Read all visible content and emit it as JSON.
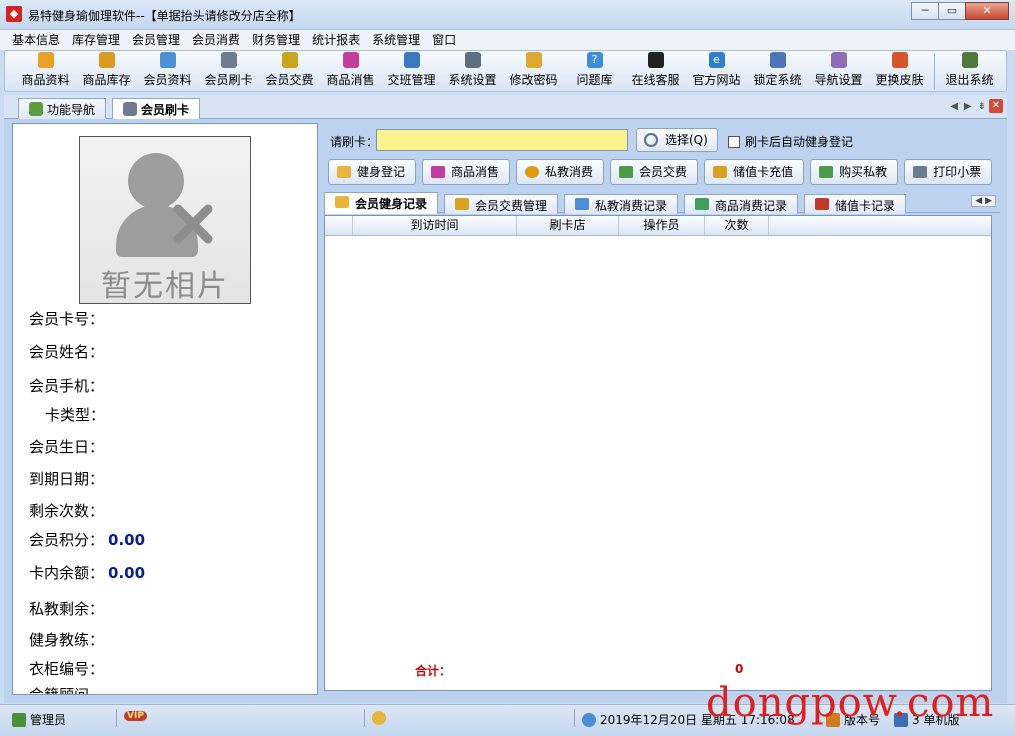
{
  "window": {
    "title": "易特健身瑜伽理软件--【单据抬头请修改分店全称】",
    "minimize": "─",
    "maximize": "▭",
    "close": "✕"
  },
  "menu": [
    "基本信息",
    "库存管理",
    "会员管理",
    "会员消费",
    "财务管理",
    "统计报表",
    "系统管理",
    "窗口"
  ],
  "toolbar": [
    {
      "label": "商品资料",
      "icon": "product-info-icon",
      "color": "#e9a123"
    },
    {
      "label": "商品库存",
      "icon": "inventory-icon",
      "color": "#d99a1e"
    },
    {
      "label": "会员资料",
      "icon": "member-info-icon",
      "color": "#4a8fd4"
    },
    {
      "label": "会员刷卡",
      "icon": "card-swipe-icon",
      "color": "#6d7c8f"
    },
    {
      "label": "会员交费",
      "icon": "payment-icon",
      "color": "#c9a51b"
    },
    {
      "label": "商品消售",
      "icon": "sales-icon",
      "color": "#c43c9e"
    },
    {
      "label": "交班管理",
      "icon": "shift-icon",
      "color": "#3a78c2"
    },
    {
      "label": "系统设置",
      "icon": "settings-icon",
      "color": "#5f6f82"
    },
    {
      "label": "修改密码",
      "icon": "key-icon",
      "color": "#e0a62e"
    },
    {
      "label": "问题库",
      "icon": "question-icon",
      "color": "#3b8fd9"
    },
    {
      "label": "在线客服",
      "icon": "qq-icon",
      "color": "#222222"
    },
    {
      "label": "官方网站",
      "icon": "ie-icon",
      "color": "#2f7fd0"
    },
    {
      "label": "锁定系统",
      "icon": "lock-icon",
      "color": "#4d76b8"
    },
    {
      "label": "导航设置",
      "icon": "nav-settings-icon",
      "color": "#8d6db8"
    },
    {
      "label": "更换皮肤",
      "icon": "skin-icon",
      "color": "#d9532b"
    },
    {
      "label": "退出系统",
      "icon": "exit-icon",
      "color": "#4f7a3a"
    }
  ],
  "doc_tabs": [
    {
      "label": "功能导航",
      "active": false
    },
    {
      "label": "会员刷卡",
      "active": true
    }
  ],
  "doc_tab_nav": {
    "prev": "◀",
    "next": "▶",
    "menu": "⇟",
    "close": "✕"
  },
  "photo": {
    "placeholder": "暂无相片"
  },
  "member_fields": [
    {
      "label": "会员卡号：",
      "value": ""
    },
    {
      "label": "会员姓名：",
      "value": ""
    },
    {
      "label": "会员手机：",
      "value": ""
    },
    {
      "label": "卡类型：",
      "value": ""
    },
    {
      "label": "会员生日：",
      "value": ""
    },
    {
      "label": "到期日期：",
      "value": ""
    },
    {
      "label": "剩余次数：",
      "value": ""
    },
    {
      "label": "会员积分：",
      "value": "0.00"
    },
    {
      "label": "卡内余额：",
      "value": "0.00"
    },
    {
      "label": "私教剩余：",
      "value": ""
    },
    {
      "label": "健身教练：",
      "value": ""
    },
    {
      "label": "衣柜编号：",
      "value": ""
    },
    {
      "label": "会籍顾问",
      "value": ""
    }
  ],
  "card": {
    "label": "请刷卡：",
    "value": "",
    "select_button": "选择(Q)",
    "auto_checkin_label": "刷卡后自动健身登记",
    "auto_checkin_checked": false
  },
  "actions": [
    {
      "label": "健身登记",
      "color": "#e8b43a"
    },
    {
      "label": "商品消售",
      "color": "#c43c9e"
    },
    {
      "label": "私教消费",
      "color": "#e09a12"
    },
    {
      "label": "会员交费",
      "color": "#4b9b4b"
    },
    {
      "label": "储值卡充值",
      "color": "#d9a322"
    },
    {
      "label": "购买私教",
      "color": "#4b9b4b"
    },
    {
      "label": "打印小票",
      "color": "#6b7b90"
    }
  ],
  "record_tabs": [
    {
      "label": "会员健身记录",
      "active": true,
      "color": "#e8b43a"
    },
    {
      "label": "会员交费管理",
      "active": false,
      "color": "#d9a322"
    },
    {
      "label": "私教消费记录",
      "active": false,
      "color": "#4a8fd4"
    },
    {
      "label": "商品消费记录",
      "active": false,
      "color": "#3fa05a"
    },
    {
      "label": "储值卡记录",
      "active": false,
      "color": "#c0392b"
    }
  ],
  "record_tab_nav": "◀ ▶",
  "grid": {
    "columns": [
      "",
      "到访时间",
      "刷卡店",
      "操作员",
      "次数"
    ],
    "rows": [],
    "total_label": "合计：",
    "total_value": "0"
  },
  "status": {
    "user": "管理员",
    "vip_badge": "VIP",
    "datetime": "2019年12月20日 星期五 17:16:08",
    "version": "版本号",
    "edition": "3 单机版"
  },
  "watermark": "dongpow.com"
}
